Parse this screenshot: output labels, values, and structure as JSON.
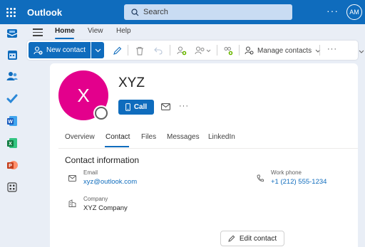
{
  "app": {
    "name": "Outlook",
    "user_initials": "AM"
  },
  "search": {
    "placeholder": "Search"
  },
  "ribbon": {
    "tabs": [
      {
        "label": "Home",
        "active": true
      },
      {
        "label": "View",
        "active": false
      },
      {
        "label": "Help",
        "active": false
      }
    ],
    "new_contact_label": "New contact",
    "manage_contacts_label": "Manage contacts"
  },
  "rail": [
    "mail-icon",
    "calendar-icon",
    "people-icon",
    "todo-icon",
    "word-icon",
    "excel-icon",
    "powerpoint-icon",
    "more-apps-icon"
  ],
  "contact": {
    "initial": "X",
    "name": "XYZ",
    "call_label": "Call",
    "avatar_color": "#e3008c",
    "tabs": [
      "Overview",
      "Contact",
      "Files",
      "Messages",
      "LinkedIn"
    ],
    "active_tab": "Contact",
    "section_title": "Contact information",
    "email_label": "Email",
    "email_value": "xyz@outlook.com",
    "phone_label": "Work phone",
    "phone_value": "+1 (212) 555-1234",
    "company_label": "Company",
    "company_value": "XYZ Company",
    "edit_label": "Edit contact"
  },
  "colors": {
    "brand": "#0f6cbd",
    "background": "#e9eef6"
  }
}
